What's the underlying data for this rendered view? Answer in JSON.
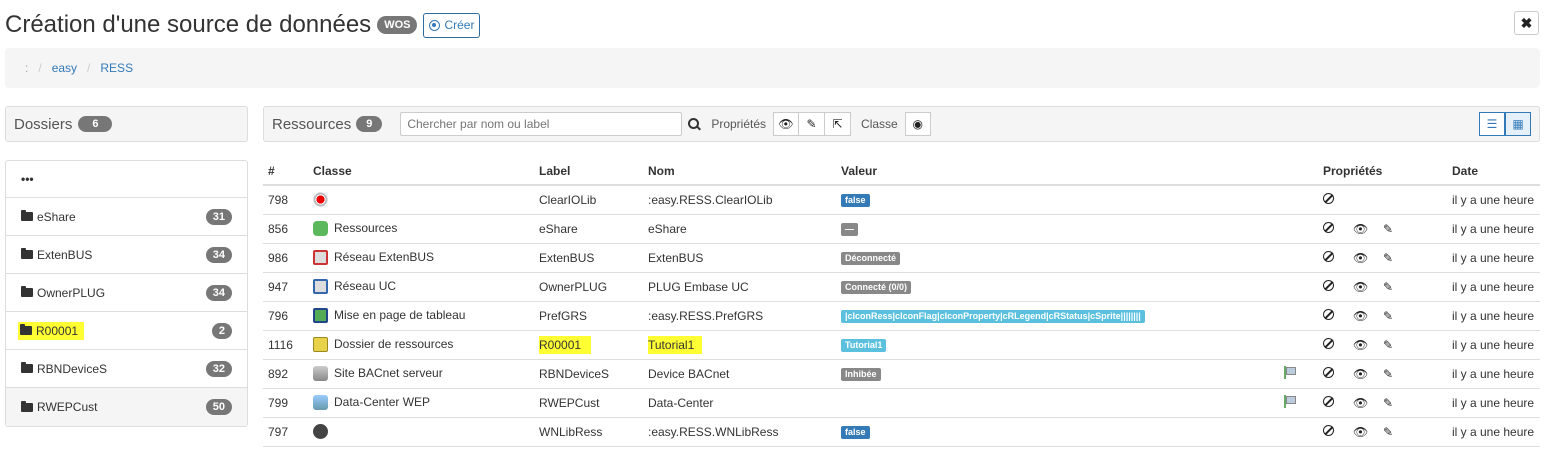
{
  "header": {
    "title": "Création d'une source de données",
    "tag": "WOS",
    "create_label": "Créer",
    "close_label": "✖"
  },
  "breadcrumb": {
    "root": ":",
    "items": [
      "easy",
      "RESS"
    ]
  },
  "folders": {
    "title": "Dossiers",
    "count": "6",
    "more": "•••",
    "items": [
      {
        "label": "eShare",
        "count": "31"
      },
      {
        "label": "ExtenBUS",
        "count": "34"
      },
      {
        "label": "OwnerPLUG",
        "count": "34"
      },
      {
        "label": "R00001",
        "count": "2"
      },
      {
        "label": "RBNDeviceS",
        "count": "32"
      },
      {
        "label": "RWEPCust",
        "count": "50"
      }
    ]
  },
  "resources": {
    "title": "Ressources",
    "count": "9",
    "search_placeholder": "Chercher par nom ou label",
    "props_label": "Propriétés",
    "class_label": "Classe",
    "columns": {
      "id": "#",
      "classe": "Classe",
      "label": "Label",
      "nom": "Nom",
      "valeur": "Valeur",
      "props": "Propriétés",
      "date": "Date"
    },
    "rows": [
      {
        "id": "798",
        "classe": "",
        "label": "ClearIOLib",
        "nom": ":easy.RESS.ClearIOLib",
        "valeur": "false",
        "date": "il y a une heure"
      },
      {
        "id": "856",
        "classe": "Ressources",
        "label": "eShare",
        "nom": "eShare",
        "valeur": "—",
        "date": "il y a une heure"
      },
      {
        "id": "986",
        "classe": "Réseau ExtenBUS",
        "label": "ExtenBUS",
        "nom": "ExtenBUS",
        "valeur": "Déconnecté",
        "date": "il y a une heure"
      },
      {
        "id": "947",
        "classe": "Réseau UC",
        "label": "OwnerPLUG",
        "nom": "PLUG Embase UC",
        "valeur": "Connecté (0/0)",
        "date": "il y a une heure"
      },
      {
        "id": "796",
        "classe": "Mise en page de tableau",
        "label": "PrefGRS",
        "nom": ":easy.RESS.PrefGRS",
        "valeur": "|cIconRess|cIconFlag|cIconProperty|cRLegend|cRStatus|cSprite||||||||",
        "date": "il y a une heure"
      },
      {
        "id": "1116",
        "classe": "Dossier de ressources",
        "label": "R00001",
        "nom": "Tutorial1",
        "valeur": "Tutorial1",
        "date": "il y a une heure"
      },
      {
        "id": "892",
        "classe": "Site BACnet serveur",
        "label": "RBNDeviceS",
        "nom": "Device BACnet",
        "valeur": "Inhibée",
        "date": "il y a une heure"
      },
      {
        "id": "799",
        "classe": "Data-Center WEP",
        "label": "RWEPCust",
        "nom": "Data-Center",
        "valeur": "",
        "date": "il y a une heure"
      },
      {
        "id": "797",
        "classe": "",
        "label": "WNLibRess",
        "nom": ":easy.RESS.WNLibRess",
        "valeur": "false",
        "date": "il y a une heure"
      }
    ]
  },
  "colors": {
    "link": "#337ab7",
    "highlight": "#ffff33",
    "badge": "#777777"
  }
}
